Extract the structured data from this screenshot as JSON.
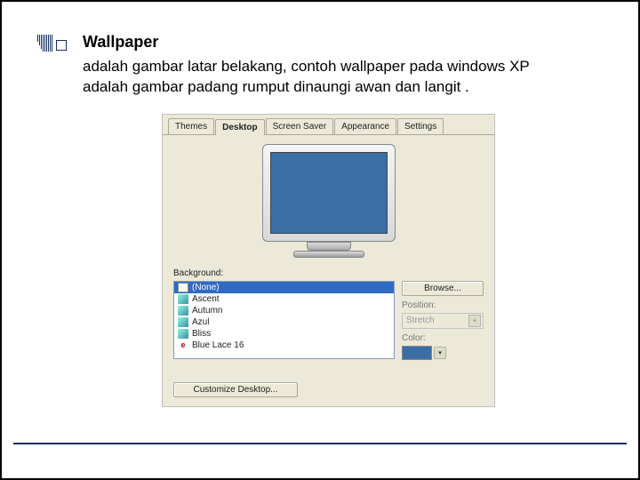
{
  "slide": {
    "title": "Wallpaper",
    "description": "adalah gambar latar belakang, contoh wallpaper pada windows XP adalah gambar padang rumput dinaungi awan dan langit ."
  },
  "dialog": {
    "tabs": [
      "Themes",
      "Desktop",
      "Screen Saver",
      "Appearance",
      "Settings"
    ],
    "active_tab": "Desktop",
    "background_label": "Background:",
    "items": [
      {
        "name": "(None)",
        "icon": "none",
        "selected": true
      },
      {
        "name": "Ascent",
        "icon": "img",
        "selected": false
      },
      {
        "name": "Autumn",
        "icon": "img",
        "selected": false
      },
      {
        "name": "Azul",
        "icon": "img",
        "selected": false
      },
      {
        "name": "Bliss",
        "icon": "img",
        "selected": false
      },
      {
        "name": "Blue Lace 16",
        "icon": "html",
        "selected": false
      }
    ],
    "browse_btn": "Browse...",
    "position_label": "Position:",
    "position_value": "Stretch",
    "color_label": "Color:",
    "customize_btn": "Customize Desktop..."
  }
}
